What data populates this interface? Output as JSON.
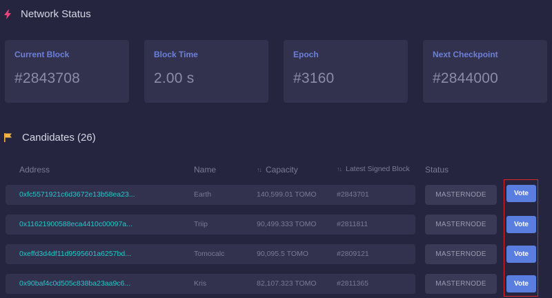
{
  "network": {
    "title": "Network Status",
    "stats": [
      {
        "label": "Current Block",
        "value": "#2843708"
      },
      {
        "label": "Block Time",
        "value": "2.00 s"
      },
      {
        "label": "Epoch",
        "value": "#3160"
      },
      {
        "label": "Next Checkpoint",
        "value": "#2844000"
      }
    ]
  },
  "candidates": {
    "title": "Candidates (26)",
    "columns": {
      "address": "Address",
      "name": "Name",
      "capacity": "Capacity",
      "latest_signed": "Latest Signed Block",
      "status": "Status"
    },
    "sort_glyph": "↑↓",
    "rows": [
      {
        "address": "0xfc5571921c6d3672e13b58ea23...",
        "name": "Earth",
        "capacity": "140,599.01 TOMO",
        "latest_signed": "#2843701",
        "status": "MASTERNODE",
        "action": "Vote"
      },
      {
        "address": "0x11621900588eca4410c00097a...",
        "name": "Triip",
        "capacity": "90,499.333 TOMO",
        "latest_signed": "#2811811",
        "status": "MASTERNODE",
        "action": "Vote"
      },
      {
        "address": "0xeffd3d4df11d9595601a6257bd...",
        "name": "Tomocalc",
        "capacity": "90,095.5 TOMO",
        "latest_signed": "#2809121",
        "status": "MASTERNODE",
        "action": "Vote"
      },
      {
        "address": "0x90baf4c0d505c838ba23aa9c6...",
        "name": "Kris",
        "capacity": "82,107.323 TOMO",
        "latest_signed": "#2811365",
        "status": "MASTERNODE",
        "action": "Vote"
      }
    ]
  },
  "colors": {
    "background": "#252540",
    "card": "#32324f",
    "accent_label": "#6c80d8",
    "address_link": "#22c9c9",
    "vote_button": "#5a7ee0",
    "network_icon": "#e8457a",
    "candidates_icon": "#f2b544",
    "highlight": "#e02a2a"
  },
  "icons": {
    "network": "lightning-icon",
    "candidates": "flag-icon"
  }
}
